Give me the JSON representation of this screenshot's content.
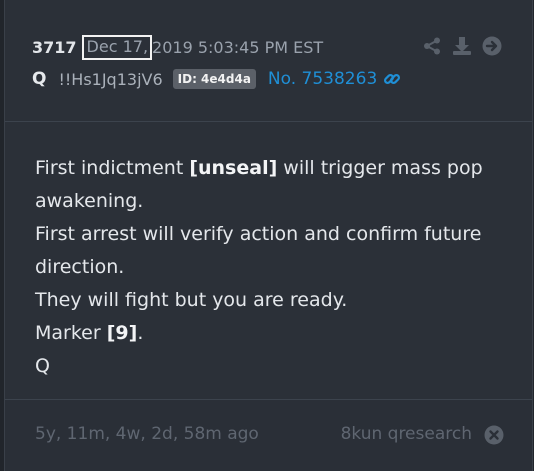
{
  "post": {
    "number": "3717",
    "date": "Dec 17,",
    "time_rest": "2019 5:03:45 PM EST",
    "author": "Q",
    "tripcode": "!!Hs1Jq13jV6",
    "id_badge": "ID: 4e4d4a",
    "link_text": "No. 7538263"
  },
  "body": {
    "l1_a": "First indictment ",
    "l1_b": "[unseal]",
    "l1_c": " will trigger mass pop awakening.",
    "l2": "First arrest will verify action and confirm future direction.",
    "l3": "They will fight but you are ready.",
    "l4_a": "Marker ",
    "l4_b": "[9]",
    "l4_c": ".",
    "l5": "Q"
  },
  "footer": {
    "age": "5y, 11m, 4w, 2d, 58m ago",
    "source": "8kun qresearch"
  },
  "icons": {
    "share": "share-icon",
    "download": "download-icon",
    "next": "arrow-circle-right-icon",
    "link": "link-icon",
    "close": "close-circle-icon"
  },
  "colors": {
    "background": "#2b3038",
    "link": "#1f8fd6",
    "text": "#e4e7eb",
    "muted": "#5f6671"
  }
}
